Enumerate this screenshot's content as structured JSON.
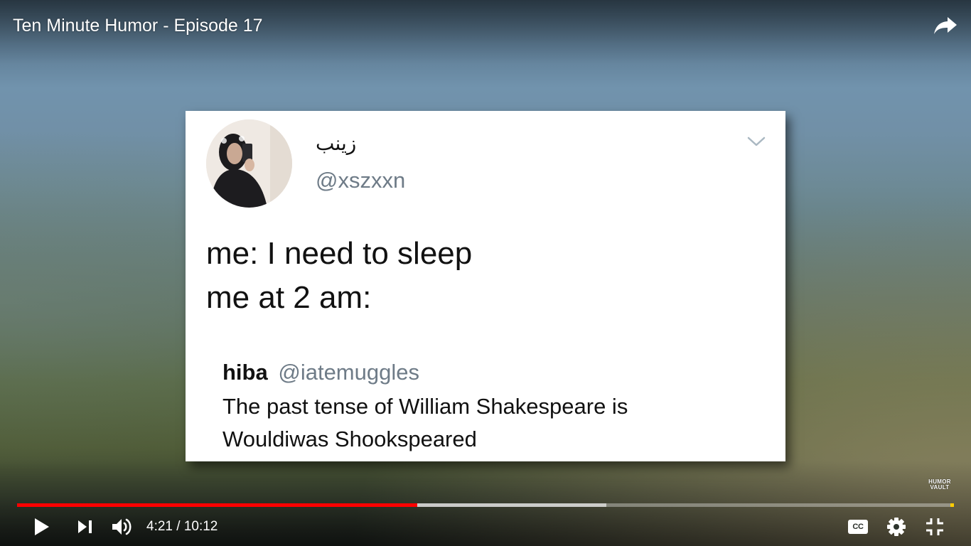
{
  "player": {
    "title": "Ten Minute Humor - Episode 17",
    "share_icon": "share-arrow-icon",
    "watermark_line1": "HUMOR",
    "watermark_line2": "VAULT",
    "progress": {
      "played_fraction": 0.427,
      "buffered_fraction": 0.629,
      "played_color": "#ff0000",
      "marker_color": "#ffcc00"
    },
    "controls": {
      "current_time": "4:21",
      "separator": " / ",
      "duration": "10:12",
      "play_icon": "play-icon",
      "next_icon": "skip-next-icon",
      "volume_icon": "volume-icon",
      "cc_label": "CC",
      "settings_icon": "gear-icon",
      "fullscreen_icon": "exit-fullscreen-icon"
    }
  },
  "tweet": {
    "display_name": "زينب",
    "handle": "@xszxxn",
    "lines": [
      "me: I need to sleep",
      "me at 2 am:"
    ],
    "quoted": {
      "name": "hiba",
      "handle": "@iatemuggles",
      "lines": [
        "The past tense of William Shakespeare is",
        "Wouldiwas Shookspeared"
      ]
    }
  }
}
